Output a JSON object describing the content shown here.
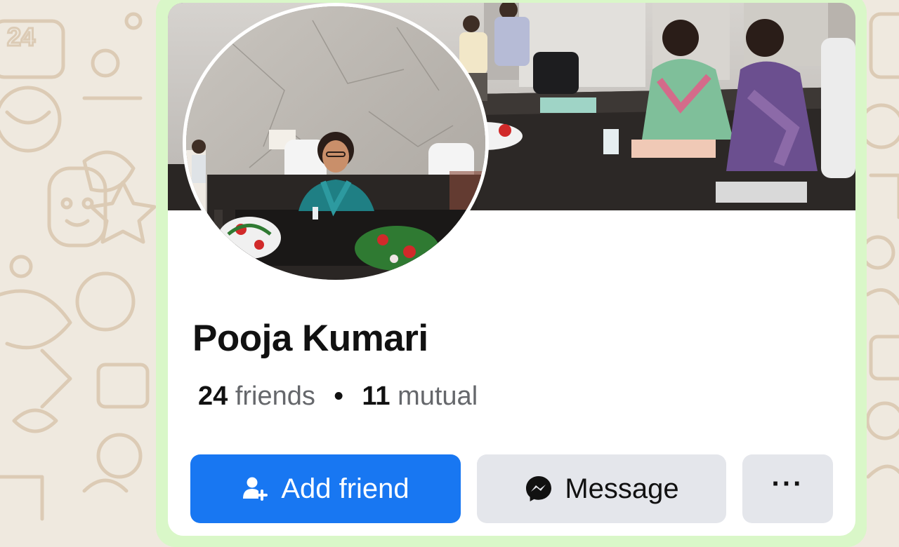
{
  "profile": {
    "name": "Pooja Kumari",
    "friends_count": "24",
    "friends_label": "friends",
    "separator": "•",
    "mutual_count": "11",
    "mutual_label": "mutual"
  },
  "actions": {
    "add_friend_label": "Add friend",
    "message_label": "Message",
    "more_label": "···"
  },
  "wallpaper_text": {
    "number": "24"
  },
  "colors": {
    "primary": "#1877f2",
    "secondary_button": "#e4e6eb",
    "bubble": "#d9f7c8",
    "wallpaper": "#efe9df"
  },
  "icons": {
    "add_friend": "person-add-icon",
    "message": "messenger-icon",
    "more": "more-dots-icon"
  }
}
